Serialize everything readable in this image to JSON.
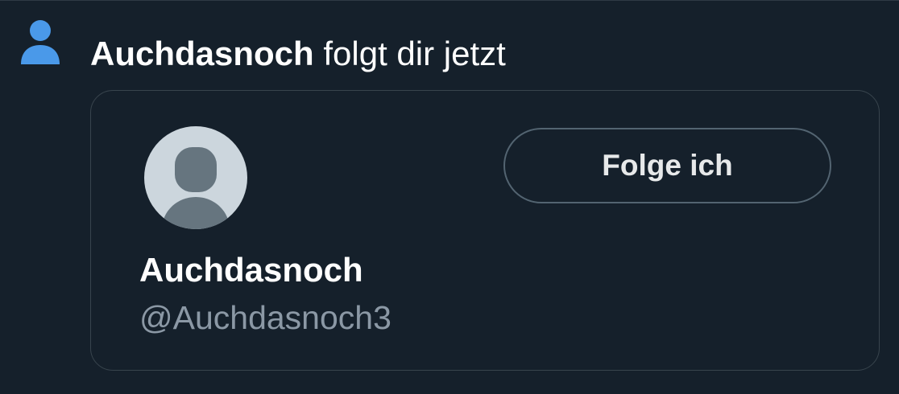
{
  "notification": {
    "actor_name": "Auchdasnoch",
    "action_text": " folgt dir jetzt",
    "icon": "person-follow-icon",
    "icon_color": "#4a99e9"
  },
  "user_card": {
    "display_name": "Auchdasnoch",
    "handle": "@Auchdasnoch3",
    "avatar_icon": "default-avatar-icon",
    "follow_button_label": "Folge ich"
  },
  "colors": {
    "background": "#15202b",
    "card_border": "#38444d",
    "text_primary": "#ffffff",
    "text_secondary": "#8b98a5",
    "button_border": "#536471",
    "avatar_bg": "#ccd6dd",
    "avatar_fg": "#66757f"
  }
}
